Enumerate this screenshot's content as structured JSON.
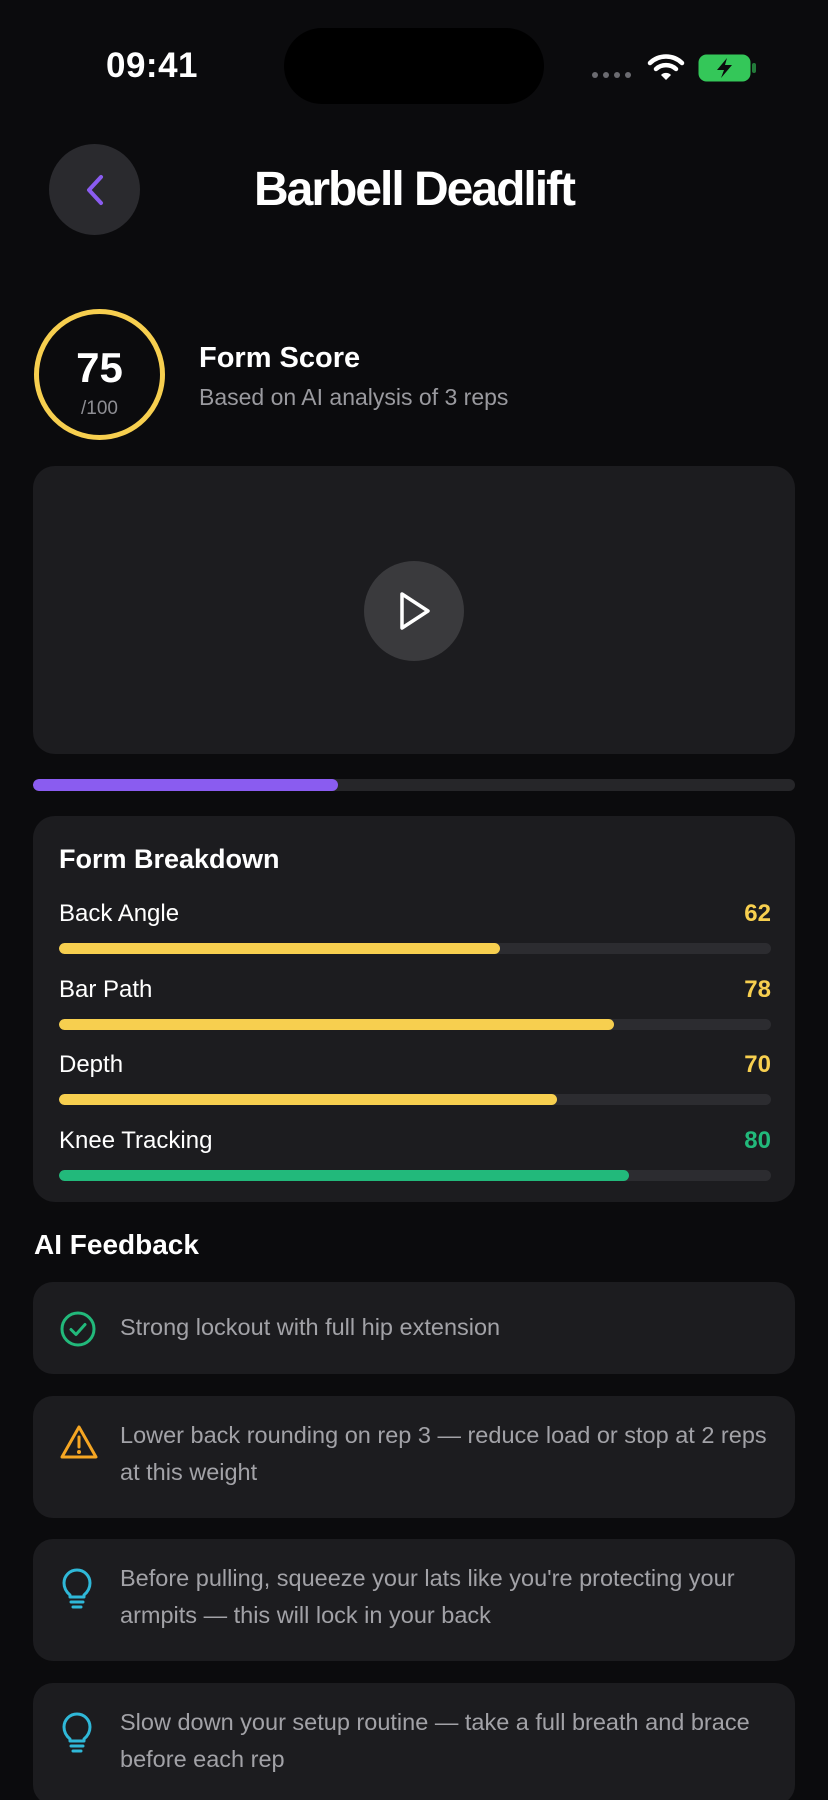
{
  "status_bar": {
    "time": "09:41"
  },
  "header": {
    "title": "Barbell Deadlift"
  },
  "score": {
    "value": "75",
    "max_label": "/100",
    "title": "Form Score",
    "subtitle": "Based on AI analysis of 3 reps",
    "ring_color": "#f7cf4f"
  },
  "video": {
    "progress_percent": 40
  },
  "breakdown": {
    "title": "Form Breakdown",
    "metrics": [
      {
        "label": "Back Angle",
        "value": "62",
        "score": 62,
        "color": "#f7cf4f"
      },
      {
        "label": "Bar Path",
        "value": "78",
        "score": 78,
        "color": "#f7cf4f"
      },
      {
        "label": "Depth",
        "value": "70",
        "score": 70,
        "color": "#f7cf4f"
      },
      {
        "label": "Knee Tracking",
        "value": "80",
        "score": 80,
        "color": "#22b97b"
      }
    ]
  },
  "feedback": {
    "title": "AI Feedback",
    "items": [
      {
        "icon": "check-circle-icon",
        "text": "Strong lockout with full hip extension",
        "color": "#22b97b"
      },
      {
        "icon": "warning-icon",
        "text": "Lower back rounding on rep 3 — reduce load or stop at 2 reps at this weight",
        "color": "#f5a623"
      },
      {
        "icon": "lightbulb-icon",
        "text": "Before pulling, squeeze your lats like you're protecting your armpits — this will lock in your back",
        "color": "#2fb8d8"
      },
      {
        "icon": "lightbulb-icon",
        "text": "Slow down your setup routine — take a full breath and brace before each rep",
        "color": "#2fb8d8"
      }
    ]
  },
  "colors": {
    "accent": "#8a5cf0",
    "background": "#0b0b0d",
    "card": "#1c1c1f"
  }
}
